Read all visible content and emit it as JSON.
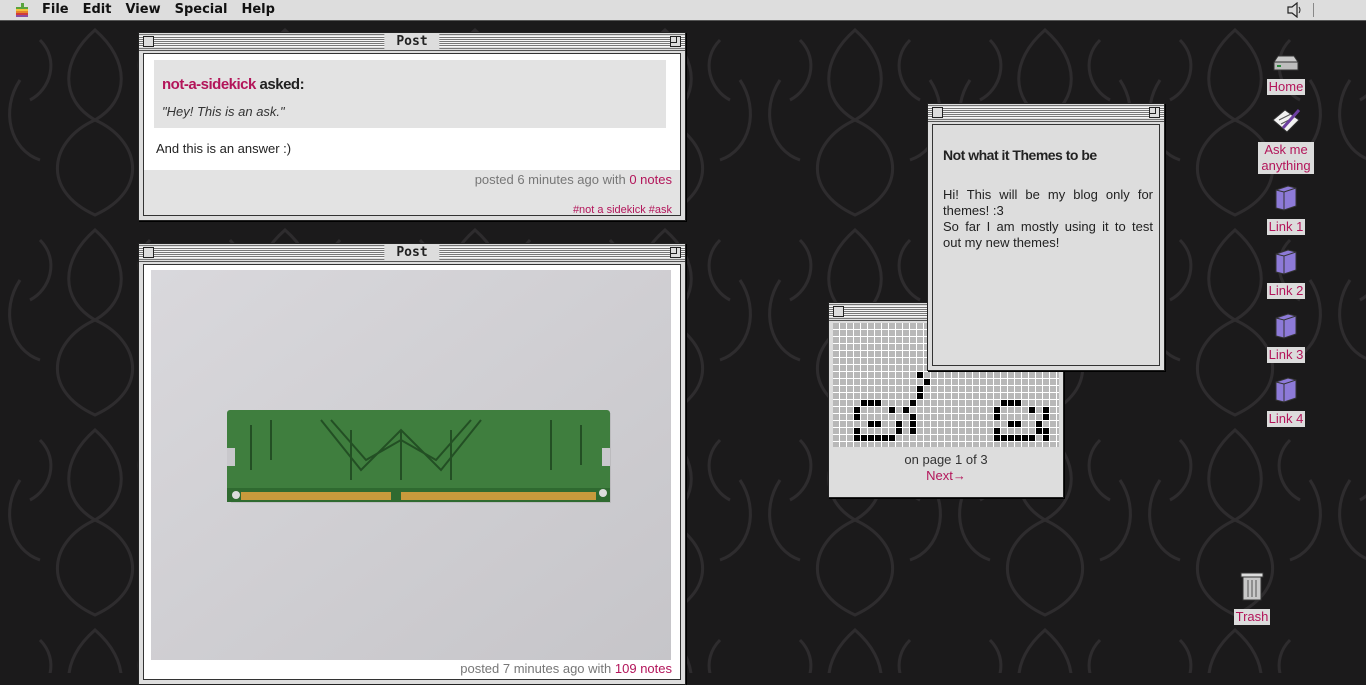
{
  "menubar": {
    "items": [
      "File",
      "Edit",
      "View",
      "Special",
      "Help"
    ]
  },
  "colors": {
    "accent": "#b3155a",
    "desktop": "#1b1a1b",
    "window": "#dddddd"
  },
  "post1": {
    "title": "Post",
    "asker": "not-a-sidekick",
    "asked_word": "asked:",
    "question": "\"Hey! This is an ask.\"",
    "answer": "And this is an answer :)",
    "posted_prefix": "posted 6 minutes ago with ",
    "notes": "0 notes",
    "tags": "#not a sidekick #ask"
  },
  "post2": {
    "title": "Post",
    "posted_prefix": "posted 7 minutes ago with ",
    "notes": "109 notes"
  },
  "description": {
    "title": "Not what it Themes to be",
    "text_lines": [
      "Hi! This will be my blog only for themes! :3",
      "So far I am mostly using it to test out my new themes!"
    ]
  },
  "pager": {
    "text": "on page 1 of 3",
    "next": "Next→"
  },
  "sidebar": {
    "items": [
      {
        "label": "Home",
        "icon": "hard-drive-icon"
      },
      {
        "label": "Ask me anything",
        "icon": "pen-icon"
      },
      {
        "label": "Link 1",
        "icon": "folder-icon"
      },
      {
        "label": "Link 2",
        "icon": "folder-icon"
      },
      {
        "label": "Link 3",
        "icon": "folder-icon"
      },
      {
        "label": "Link 4",
        "icon": "folder-icon"
      }
    ],
    "trash_label": "Trash"
  }
}
